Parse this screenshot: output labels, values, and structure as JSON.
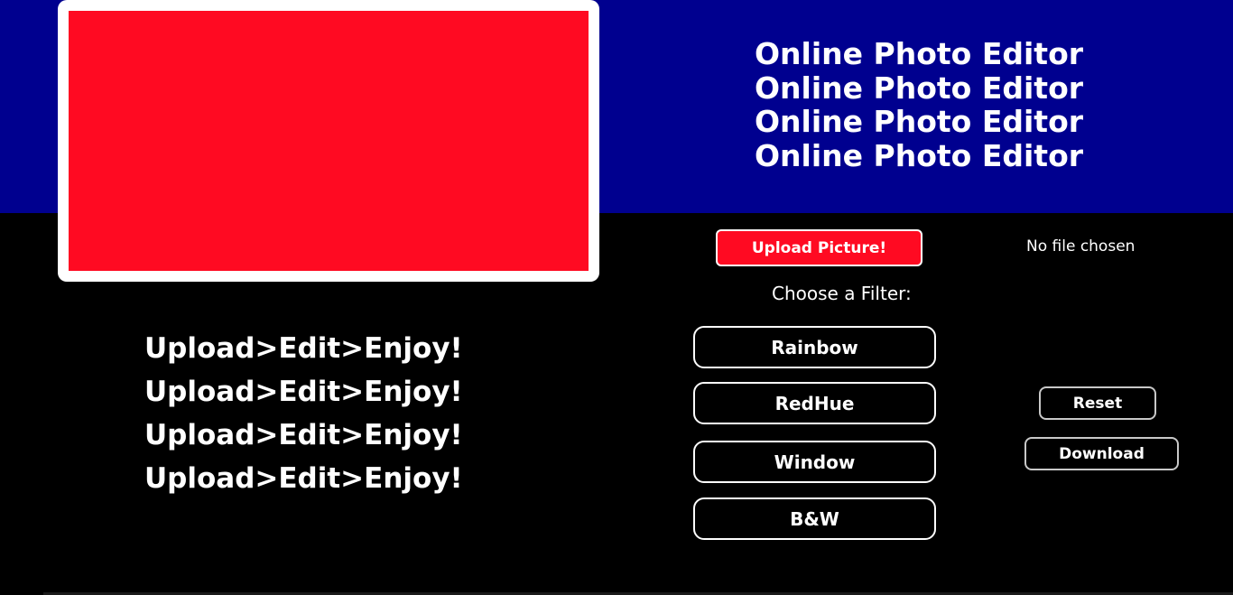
{
  "header": {
    "title_lines": [
      "Online Photo Editor",
      "Online Photo Editor",
      "Online Photo Editor",
      "Online Photo Editor"
    ]
  },
  "upload": {
    "button_label": "Upload Picture!",
    "file_status": "No file chosen"
  },
  "filters": {
    "label": "Choose a Filter:",
    "buttons": [
      "Rainbow",
      "RedHue",
      "Window",
      "B&W"
    ]
  },
  "actions": {
    "reset_label": "Reset",
    "download_label": "Download"
  },
  "tagline": {
    "lines": [
      "Upload>Edit>Enjoy!",
      "Upload>Edit>Enjoy!",
      "Upload>Edit>Enjoy!",
      "Upload>Edit>Enjoy!"
    ]
  },
  "colors": {
    "header_band": "#00008f",
    "canvas_fill": "#ff0a22",
    "upload_button": "#ff0a22",
    "background": "#000000"
  }
}
